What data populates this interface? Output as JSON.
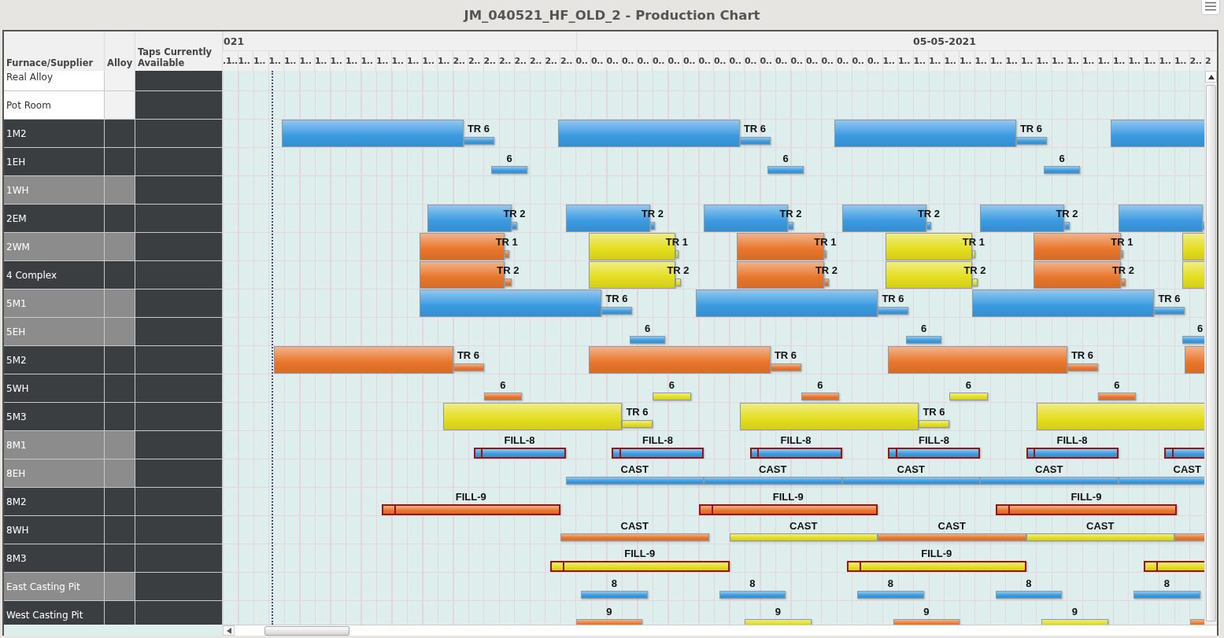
{
  "title": "JM_040521_HF_OLD_2 - Production Chart",
  "columns": [
    "Furnace/Supplier",
    "Alloy",
    "Taps Currently Available"
  ],
  "timeline": {
    "days": [
      "021",
      "05-05-2021"
    ],
    "ticks": [
      ".1..",
      "1..",
      "1..",
      "1..",
      "1..",
      "1..",
      "1..",
      "1..",
      "1..",
      "1..",
      "1..",
      "1..",
      "1..",
      "1..",
      "1..",
      "2..",
      "2..",
      "2..",
      "2..",
      "2..",
      "2..",
      "2..",
      "2..",
      "0..",
      "0..",
      "0..",
      "0..",
      "0..",
      "0..",
      "0..",
      "0..",
      "0..",
      "0..",
      "0..",
      "0..",
      "0..",
      "0..",
      "0..",
      "0..",
      "0..",
      "0..",
      "0..",
      "0..",
      "1..",
      "1..",
      "1..",
      "1..",
      "1..",
      "1..",
      "1..",
      "1..",
      "1..",
      "1..",
      "1..",
      "1..",
      "1..",
      "1..",
      "1..",
      "1..",
      "1..",
      "1..",
      "1..",
      "1..",
      "2..",
      "2"
    ]
  },
  "rows": [
    {
      "name": "Real Alloy",
      "kind": "supplier"
    },
    {
      "name": "Pot Room",
      "kind": "supplier"
    },
    {
      "name": "1M2",
      "kind": "furnace",
      "events": [
        {
          "kind": "run",
          "color": "#3a9ae0",
          "label": "TR 6"
        },
        {
          "kind": "run",
          "color": "#3a9ae0",
          "label": "TR 6"
        },
        {
          "kind": "run",
          "color": "#3a9ae0",
          "label": "TR 6"
        },
        {
          "kind": "run",
          "color": "#3a9ae0"
        }
      ]
    },
    {
      "name": "1EH",
      "kind": "furnace",
      "events": [
        {
          "kind": "slot",
          "color": "#3a9ae0",
          "label": "6"
        },
        {
          "kind": "slot",
          "color": "#3a9ae0",
          "label": "6"
        },
        {
          "kind": "slot",
          "color": "#3a9ae0",
          "label": "6"
        }
      ]
    },
    {
      "name": "1WH",
      "kind": "idle"
    },
    {
      "name": "2EM",
      "kind": "furnace",
      "events": [
        {
          "kind": "run",
          "color": "#3a9ae0",
          "label": "TR 2"
        },
        {
          "kind": "run",
          "color": "#3a9ae0",
          "label": "TR 2"
        },
        {
          "kind": "run",
          "color": "#3a9ae0",
          "label": "TR 2"
        },
        {
          "kind": "run",
          "color": "#3a9ae0",
          "label": "TR 2"
        },
        {
          "kind": "run",
          "color": "#3a9ae0",
          "label": "TR 2"
        },
        {
          "kind": "run",
          "color": "#3a9ae0"
        }
      ]
    },
    {
      "name": "2WM",
      "kind": "idle",
      "events": [
        {
          "kind": "run",
          "color": "#e8752a",
          "label": "TR 1"
        },
        {
          "kind": "run",
          "color": "#e4de1e",
          "label": "TR 1"
        },
        {
          "kind": "run",
          "color": "#e8752a",
          "label": "TR 1"
        },
        {
          "kind": "run",
          "color": "#e4de1e",
          "label": "TR 1"
        },
        {
          "kind": "run",
          "color": "#e8752a",
          "label": "TR 1"
        },
        {
          "kind": "run",
          "color": "#e4de1e"
        }
      ]
    },
    {
      "name": "4 Complex",
      "kind": "furnace",
      "events": [
        {
          "kind": "run",
          "color": "#e8752a",
          "label": "TR 2"
        },
        {
          "kind": "run",
          "color": "#e4de1e",
          "label": "TR 2"
        },
        {
          "kind": "run",
          "color": "#e8752a",
          "label": "TR 2"
        },
        {
          "kind": "run",
          "color": "#e4de1e",
          "label": "TR 2"
        },
        {
          "kind": "run",
          "color": "#e8752a",
          "label": "TR 2"
        },
        {
          "kind": "run",
          "color": "#e4de1e"
        }
      ]
    },
    {
      "name": "5M1",
      "kind": "idle",
      "events": [
        {
          "kind": "run",
          "color": "#3a9ae0",
          "label": "TR 6"
        },
        {
          "kind": "run",
          "color": "#3a9ae0",
          "label": "TR 6"
        },
        {
          "kind": "run",
          "color": "#3a9ae0",
          "label": "TR 6"
        }
      ]
    },
    {
      "name": "5EH",
      "kind": "idle",
      "events": [
        {
          "kind": "slot",
          "color": "#3a9ae0",
          "label": "6"
        },
        {
          "kind": "slot",
          "color": "#3a9ae0",
          "label": "6"
        },
        {
          "kind": "slot",
          "color": "#3a9ae0",
          "label": "6"
        }
      ]
    },
    {
      "name": "5M2",
      "kind": "furnace",
      "events": [
        {
          "kind": "run",
          "color": "#e8752a",
          "label": "TR 6"
        },
        {
          "kind": "run",
          "color": "#e8752a",
          "label": "TR 6"
        },
        {
          "kind": "run",
          "color": "#e8752a",
          "label": "TR 6"
        },
        {
          "kind": "run",
          "color": "#e8752a"
        }
      ]
    },
    {
      "name": "5WH",
      "kind": "furnace",
      "events": [
        {
          "kind": "slot",
          "color": "#e8752a",
          "label": "6"
        },
        {
          "kind": "slot",
          "color": "#e4de1e",
          "label": "6"
        },
        {
          "kind": "slot",
          "color": "#e8752a",
          "label": "6"
        },
        {
          "kind": "slot",
          "color": "#e4de1e",
          "label": "6"
        },
        {
          "kind": "slot",
          "color": "#e8752a",
          "label": "6"
        }
      ]
    },
    {
      "name": "5M3",
      "kind": "furnace",
      "events": [
        {
          "kind": "run",
          "color": "#e4de1e",
          "label": "TR 6"
        },
        {
          "kind": "run",
          "color": "#e4de1e",
          "label": "TR 6"
        },
        {
          "kind": "run",
          "color": "#e4de1e"
        }
      ]
    },
    {
      "name": "8M1",
      "kind": "idle",
      "events": [
        {
          "kind": "fill",
          "color": "#3a9ae0",
          "label": "FILL-8"
        },
        {
          "kind": "fill",
          "color": "#3a9ae0",
          "label": "FILL-8"
        },
        {
          "kind": "fill",
          "color": "#3a9ae0",
          "label": "FILL-8"
        },
        {
          "kind": "fill",
          "color": "#3a9ae0",
          "label": "FILL-8"
        },
        {
          "kind": "fill",
          "color": "#3a9ae0",
          "label": "FILL-8"
        },
        {
          "kind": "fill",
          "color": "#3a9ae0"
        }
      ]
    },
    {
      "name": "8EH",
      "kind": "idle",
      "events": [
        {
          "kind": "cast",
          "color": "#3a9ae0",
          "label": "CAST"
        },
        {
          "kind": "cast",
          "color": "#3a9ae0",
          "label": "CAST"
        },
        {
          "kind": "cast",
          "color": "#3a9ae0",
          "label": "CAST"
        },
        {
          "kind": "cast",
          "color": "#3a9ae0",
          "label": "CAST"
        },
        {
          "kind": "cast",
          "color": "#3a9ae0",
          "label": "CAST"
        }
      ]
    },
    {
      "name": "8M2",
      "kind": "furnace",
      "events": [
        {
          "kind": "fill",
          "color": "#e8752a",
          "label": "FILL-9"
        },
        {
          "kind": "fill",
          "color": "#e8752a",
          "label": "FILL-9"
        },
        {
          "kind": "fill",
          "color": "#e8752a",
          "label": "FILL-9"
        }
      ]
    },
    {
      "name": "8WH",
      "kind": "furnace",
      "events": [
        {
          "kind": "cast",
          "color": "#e8752a",
          "label": "CAST"
        },
        {
          "kind": "cast",
          "color": "#e4de1e",
          "label": "CAST"
        },
        {
          "kind": "cast",
          "color": "#e8752a",
          "label": "CAST"
        },
        {
          "kind": "cast",
          "color": "#e4de1e",
          "label": "CAST"
        },
        {
          "kind": "cast",
          "color": "#e8752a"
        }
      ]
    },
    {
      "name": "8M3",
      "kind": "furnace",
      "events": [
        {
          "kind": "fill",
          "color": "#e4de1e",
          "label": "FILL-9"
        },
        {
          "kind": "fill",
          "color": "#e4de1e",
          "label": "FILL-9"
        },
        {
          "kind": "fill",
          "color": "#e4de1e"
        }
      ]
    },
    {
      "name": "East Casting Pit",
      "kind": "idle",
      "events": [
        {
          "kind": "slot",
          "color": "#3a9ae0",
          "label": "8"
        },
        {
          "kind": "slot",
          "color": "#3a9ae0",
          "label": "8"
        },
        {
          "kind": "slot",
          "color": "#3a9ae0",
          "label": "8"
        },
        {
          "kind": "slot",
          "color": "#3a9ae0",
          "label": "8"
        },
        {
          "kind": "slot",
          "color": "#3a9ae0",
          "label": "8"
        }
      ]
    },
    {
      "name": "West Casting Pit",
      "kind": "furnace",
      "events": [
        {
          "kind": "slot",
          "color": "#e8752a",
          "label": "9"
        },
        {
          "kind": "slot",
          "color": "#e4de1e",
          "label": "9"
        },
        {
          "kind": "slot",
          "color": "#e8752a",
          "label": "9"
        },
        {
          "kind": "slot",
          "color": "#e4de1e",
          "label": "9"
        },
        {
          "kind": "slot",
          "color": "#e8752a"
        }
      ]
    }
  ]
}
